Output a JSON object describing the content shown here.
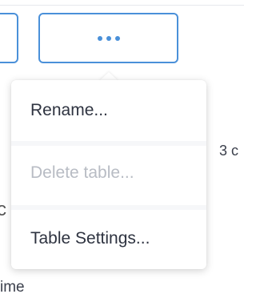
{
  "toolbar": {
    "more_button_icon": "ellipsis-horizontal-icon"
  },
  "menu": {
    "items": [
      {
        "label": "Rename...",
        "enabled": true
      },
      {
        "label": "Delete table...",
        "enabled": false
      },
      {
        "label": "Table Settings...",
        "enabled": true
      }
    ]
  },
  "background": {
    "count_fragment": "3 c",
    "letter_fragment": "c",
    "time_fragment": "ime"
  },
  "colors": {
    "accent": "#4a90d9",
    "text": "#2e3340",
    "disabled_text": "#b8bcc4"
  }
}
